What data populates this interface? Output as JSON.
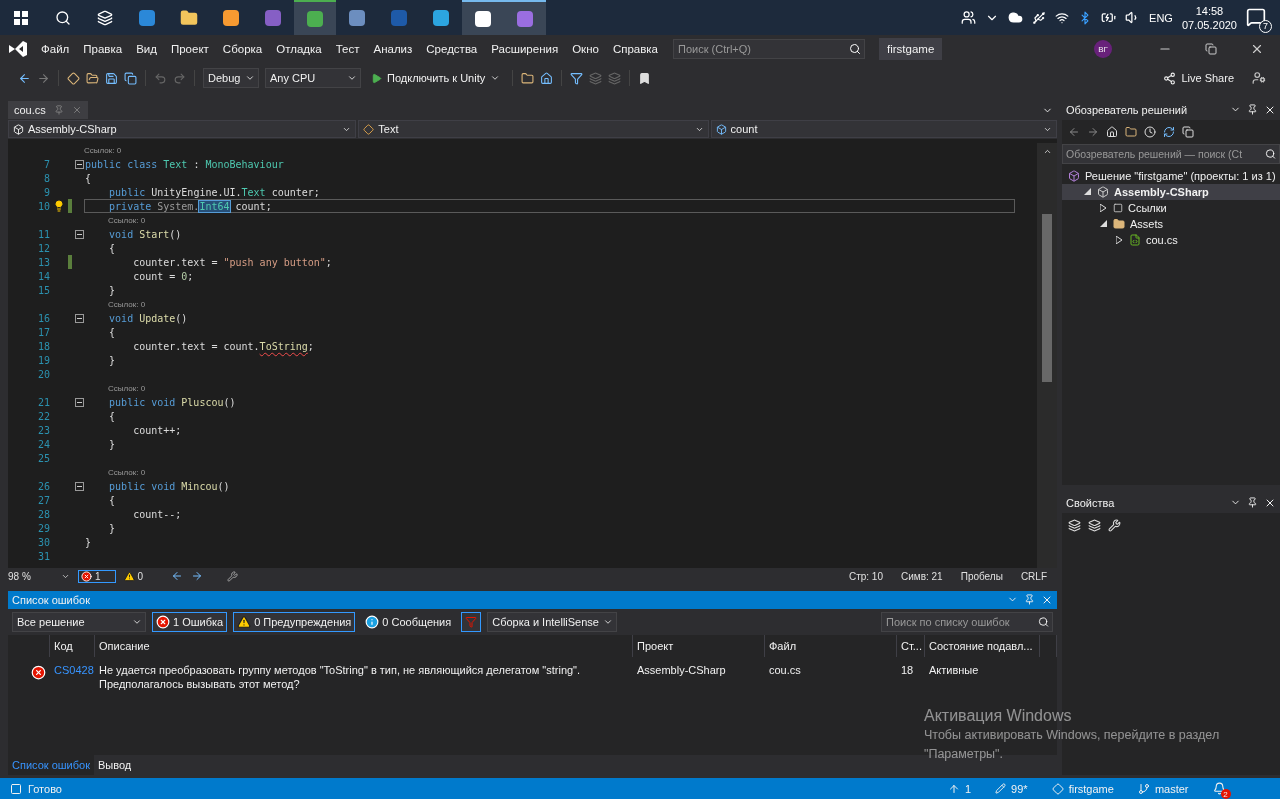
{
  "taskbar": {
    "language": "ENG",
    "time": "14:58",
    "date": "07.05.2020",
    "notifications": "7"
  },
  "title_bar": {
    "menu": [
      "Файл",
      "Правка",
      "Вид",
      "Проект",
      "Сборка",
      "Отладка",
      "Тест",
      "Анализ",
      "Средства",
      "Расширения",
      "Окно",
      "Справка"
    ],
    "search": {
      "placeholder": "Поиск (Ctrl+Q)"
    },
    "solution_name": "firstgame",
    "avatar": "ВГ"
  },
  "toolbar": {
    "configuration": "Debug",
    "platform": "Any CPU",
    "run": "Подключить к Unity",
    "live_share": "Live Share"
  },
  "editor": {
    "tabs": [
      {
        "label": "cou.cs",
        "selected": true
      }
    ],
    "nav": [
      "Assembly-CSharp",
      "Text",
      "count"
    ],
    "lines": [
      {
        "num": "7",
        "lens": "Ссылок: 0",
        "fold": true,
        "changed": false,
        "current": false,
        "bulb": false,
        "tokens": [
          {
            "kind": "kw",
            "text": "public class "
          },
          {
            "kind": "type",
            "text": "Text"
          },
          {
            "kind": "plain",
            "text": " : "
          },
          {
            "kind": "type",
            "text": "MonoBehaviour"
          }
        ]
      },
      {
        "num": "8",
        "fold": false,
        "changed": false,
        "current": false,
        "bulb": false,
        "tokens": [
          {
            "kind": "plain",
            "text": "{"
          }
        ]
      },
      {
        "num": "9",
        "fold": false,
        "changed": false,
        "current": false,
        "bulb": false,
        "tokens": [
          {
            "kind": "kw",
            "text": "    public "
          },
          {
            "kind": "plain",
            "text": "UnityEngine.UI."
          },
          {
            "kind": "type",
            "text": "Text"
          },
          {
            "kind": "plain",
            "text": " counter;"
          }
        ]
      },
      {
        "num": "10",
        "fold": false,
        "changed": true,
        "current": true,
        "bulb": true,
        "tokens": [
          {
            "kind": "kw",
            "text": "    private "
          },
          {
            "kind": "muted",
            "text": "System."
          },
          {
            "kind": "highlight",
            "text": "Int64"
          },
          {
            "kind": "plain",
            "text": " count;"
          }
        ]
      },
      {
        "num": "11",
        "lens": "Ссылок: 0",
        "fold": true,
        "changed": false,
        "current": false,
        "bulb": false,
        "tokens": [
          {
            "kind": "kw",
            "text": "    void "
          },
          {
            "kind": "method",
            "text": "Start"
          },
          {
            "kind": "plain",
            "text": "()"
          }
        ]
      },
      {
        "num": "12",
        "fold": false,
        "changed": false,
        "current": false,
        "bulb": false,
        "tokens": [
          {
            "kind": "plain",
            "text": "    {"
          }
        ]
      },
      {
        "num": "13",
        "fold": false,
        "changed": true,
        "current": false,
        "bulb": false,
        "tokens": [
          {
            "kind": "plain",
            "text": "        counter.text = "
          },
          {
            "kind": "str",
            "text": "\"push any button\""
          },
          {
            "kind": "plain",
            "text": ";"
          }
        ]
      },
      {
        "num": "14",
        "fold": false,
        "changed": false,
        "current": false,
        "bulb": false,
        "tokens": [
          {
            "kind": "plain",
            "text": "        count = "
          },
          {
            "kind": "num",
            "text": "0"
          },
          {
            "kind": "plain",
            "text": ";"
          }
        ]
      },
      {
        "num": "15",
        "fold": false,
        "changed": false,
        "current": false,
        "bulb": false,
        "tokens": [
          {
            "kind": "plain",
            "text": "    }"
          }
        ]
      },
      {
        "num": "16",
        "lens": "Ссылок: 0",
        "fold": true,
        "changed": false,
        "current": false,
        "bulb": false,
        "tokens": [
          {
            "kind": "kw",
            "text": "    void "
          },
          {
            "kind": "method",
            "text": "Update"
          },
          {
            "kind": "plain",
            "text": "()"
          }
        ]
      },
      {
        "num": "17",
        "fold": false,
        "changed": false,
        "current": false,
        "bulb": false,
        "tokens": [
          {
            "kind": "plain",
            "text": "    {"
          }
        ]
      },
      {
        "num": "18",
        "fold": false,
        "changed": false,
        "current": false,
        "bulb": false,
        "tokens": [
          {
            "kind": "plain",
            "text": "        counter.text = count."
          },
          {
            "kind": "error",
            "text": "ToString"
          },
          {
            "kind": "plain",
            "text": ";"
          }
        ]
      },
      {
        "num": "19",
        "fold": false,
        "changed": false,
        "current": false,
        "bulb": false,
        "tokens": [
          {
            "kind": "plain",
            "text": "    }"
          }
        ]
      },
      {
        "num": "20",
        "fold": false,
        "changed": false,
        "bulb": false
      },
      {
        "num": "21",
        "lens": "Ссылок: 0",
        "fold": true,
        "changed": false,
        "current": false,
        "bulb": false,
        "tokens": [
          {
            "kind": "kw",
            "text": "    public void "
          },
          {
            "kind": "method",
            "text": "Pluscou"
          },
          {
            "kind": "plain",
            "text": "()"
          }
        ]
      },
      {
        "num": "22",
        "fold": false,
        "changed": false,
        "current": false,
        "bulb": false,
        "tokens": [
          {
            "kind": "plain",
            "text": "    {"
          }
        ]
      },
      {
        "num": "23",
        "fold": false,
        "changed": false,
        "current": false,
        "bulb": false,
        "tokens": [
          {
            "kind": "plain",
            "text": "        count++;"
          }
        ]
      },
      {
        "num": "24",
        "fold": false,
        "changed": false,
        "current": false,
        "bulb": false,
        "tokens": [
          {
            "kind": "plain",
            "text": "    }"
          }
        ]
      },
      {
        "num": "25",
        "fold": false,
        "changed": false,
        "bulb": false
      },
      {
        "num": "26",
        "lens": "Ссылок: 0",
        "fold": true,
        "changed": false,
        "current": false,
        "bulb": false,
        "tokens": [
          {
            "kind": "kw",
            "text": "    public void "
          },
          {
            "kind": "method",
            "text": "Mincou"
          },
          {
            "kind": "plain",
            "text": "()"
          }
        ]
      },
      {
        "num": "27",
        "fold": false,
        "changed": false,
        "current": false,
        "bulb": false,
        "tokens": [
          {
            "kind": "plain",
            "text": "    {"
          }
        ]
      },
      {
        "num": "28",
        "fold": false,
        "changed": false,
        "current": false,
        "bulb": false,
        "tokens": [
          {
            "kind": "plain",
            "text": "        count--;"
          }
        ]
      },
      {
        "num": "29",
        "fold": false,
        "changed": false,
        "current": false,
        "bulb": false,
        "tokens": [
          {
            "kind": "plain",
            "text": "    }"
          }
        ]
      },
      {
        "num": "30",
        "fold": false,
        "changed": false,
        "current": false,
        "bulb": false,
        "tokens": [
          {
            "kind": "plain",
            "text": "}"
          }
        ]
      },
      {
        "num": "31",
        "fold": false,
        "changed": false,
        "bulb": false
      }
    ],
    "status": {
      "zoom": "98 %",
      "errors": "1",
      "warnings": "0",
      "line": "Стр: 10",
      "col": "Симв: 21",
      "indent": "Пробелы",
      "eol": "CRLF"
    }
  },
  "error_list": {
    "title": "Список ошибок",
    "scope": "Все решение",
    "filters": [
      {
        "kind": "error",
        "label": "1 Ошибка",
        "selected": true
      },
      {
        "kind": "warning",
        "label": "0 Предупреждения",
        "selected": true
      },
      {
        "kind": "info",
        "label": "0 Сообщения",
        "selected": false
      }
    ],
    "source": "Сборка и IntelliSense",
    "search": {
      "placeholder": "Поиск по списку ошибок"
    },
    "columns": [
      "Код",
      "Описание",
      "Проект",
      "Файл",
      "Ст...",
      "Состояние подавл..."
    ],
    "rows": [
      {
        "code": "CS0428",
        "description": "Не удается преобразовать группу методов \"ToString\" в тип, не являющийся делегатом \"string\". Предполагалось вызывать этот метод?",
        "project": "Assembly-CSharp",
        "file": "cou.cs",
        "line": "18",
        "state": "Активные"
      }
    ],
    "tabs": [
      {
        "label": "Список ошибок",
        "selected": true
      },
      {
        "label": "Вывод",
        "selected": false
      }
    ]
  },
  "solution_explorer": {
    "title": "Обозреватель решений",
    "search": {
      "placeholder": "Обозреватель решений — поиск (Ct"
    },
    "tree": [
      {
        "kind": "solution",
        "label": "Решение \"firstgame\" (проекты: 1 из 1)",
        "selected": false,
        "children": [
          {
            "kind": "project",
            "label": "Assembly-CSharp",
            "expanded": true,
            "selected": true,
            "children": [
              {
                "kind": "references",
                "label": "Ссылки",
                "expanded": false,
                "selected": false
              },
              {
                "kind": "folder",
                "label": "Assets",
                "expanded": true,
                "selected": false,
                "children": [
                  {
                    "kind": "file",
                    "label": "cou.cs",
                    "expanded": false,
                    "selected": false
                  }
                ]
              }
            ]
          }
        ]
      }
    ]
  },
  "properties": {
    "title": "Свойства"
  },
  "activation": {
    "title": "Активация Windows",
    "text": "Чтобы активировать Windows, перейдите в раздел \"Параметры\"."
  },
  "status_bar": {
    "message": "Готово",
    "push": "1",
    "changes": "99*",
    "repo": "firstgame",
    "branch": "master",
    "alerts": "2"
  }
}
